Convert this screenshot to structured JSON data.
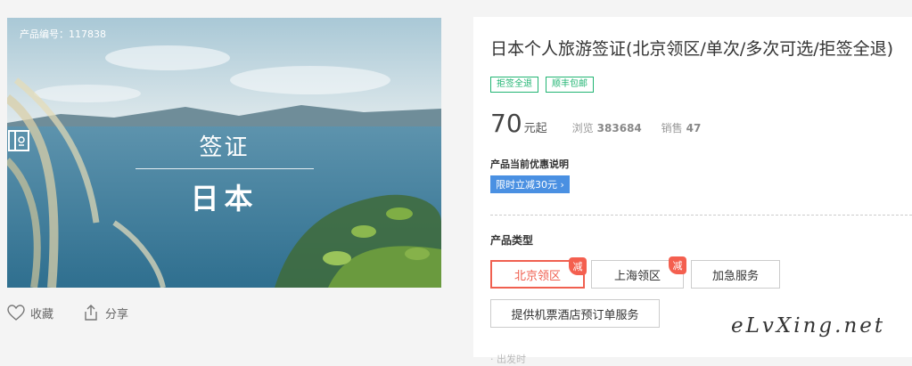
{
  "hero": {
    "product_number": "产品编号：117838",
    "visa_label": "签证",
    "country": "日本"
  },
  "actions": {
    "favorite": "收藏",
    "share": "分享"
  },
  "product": {
    "title": "日本个人旅游签证(北京领区/单次/多次可选/拒签全退)",
    "tags": [
      "拒签全退",
      "顺丰包邮"
    ],
    "price": "70",
    "price_unit": "元起",
    "views_label": "浏览",
    "views": "383684",
    "sales_label": "销售",
    "sales": "47",
    "promo_title": "产品当前优惠说明",
    "promo_badge": "限时立减30元 ›",
    "type_title": "产品类型",
    "options": [
      {
        "label": "北京领区",
        "selected": true,
        "discount_badge": "减"
      },
      {
        "label": "上海领区",
        "selected": false,
        "discount_badge": "减"
      },
      {
        "label": "加急服务",
        "selected": false
      },
      {
        "label": "提供机票酒店预订单服务",
        "selected": false
      }
    ],
    "cutoff_text": "· 出发时"
  },
  "watermark": "eLvXing.net",
  "colors": {
    "accent_green": "#22b573",
    "promo_blue": "#4a90e2",
    "selected_red": "#f06050"
  }
}
